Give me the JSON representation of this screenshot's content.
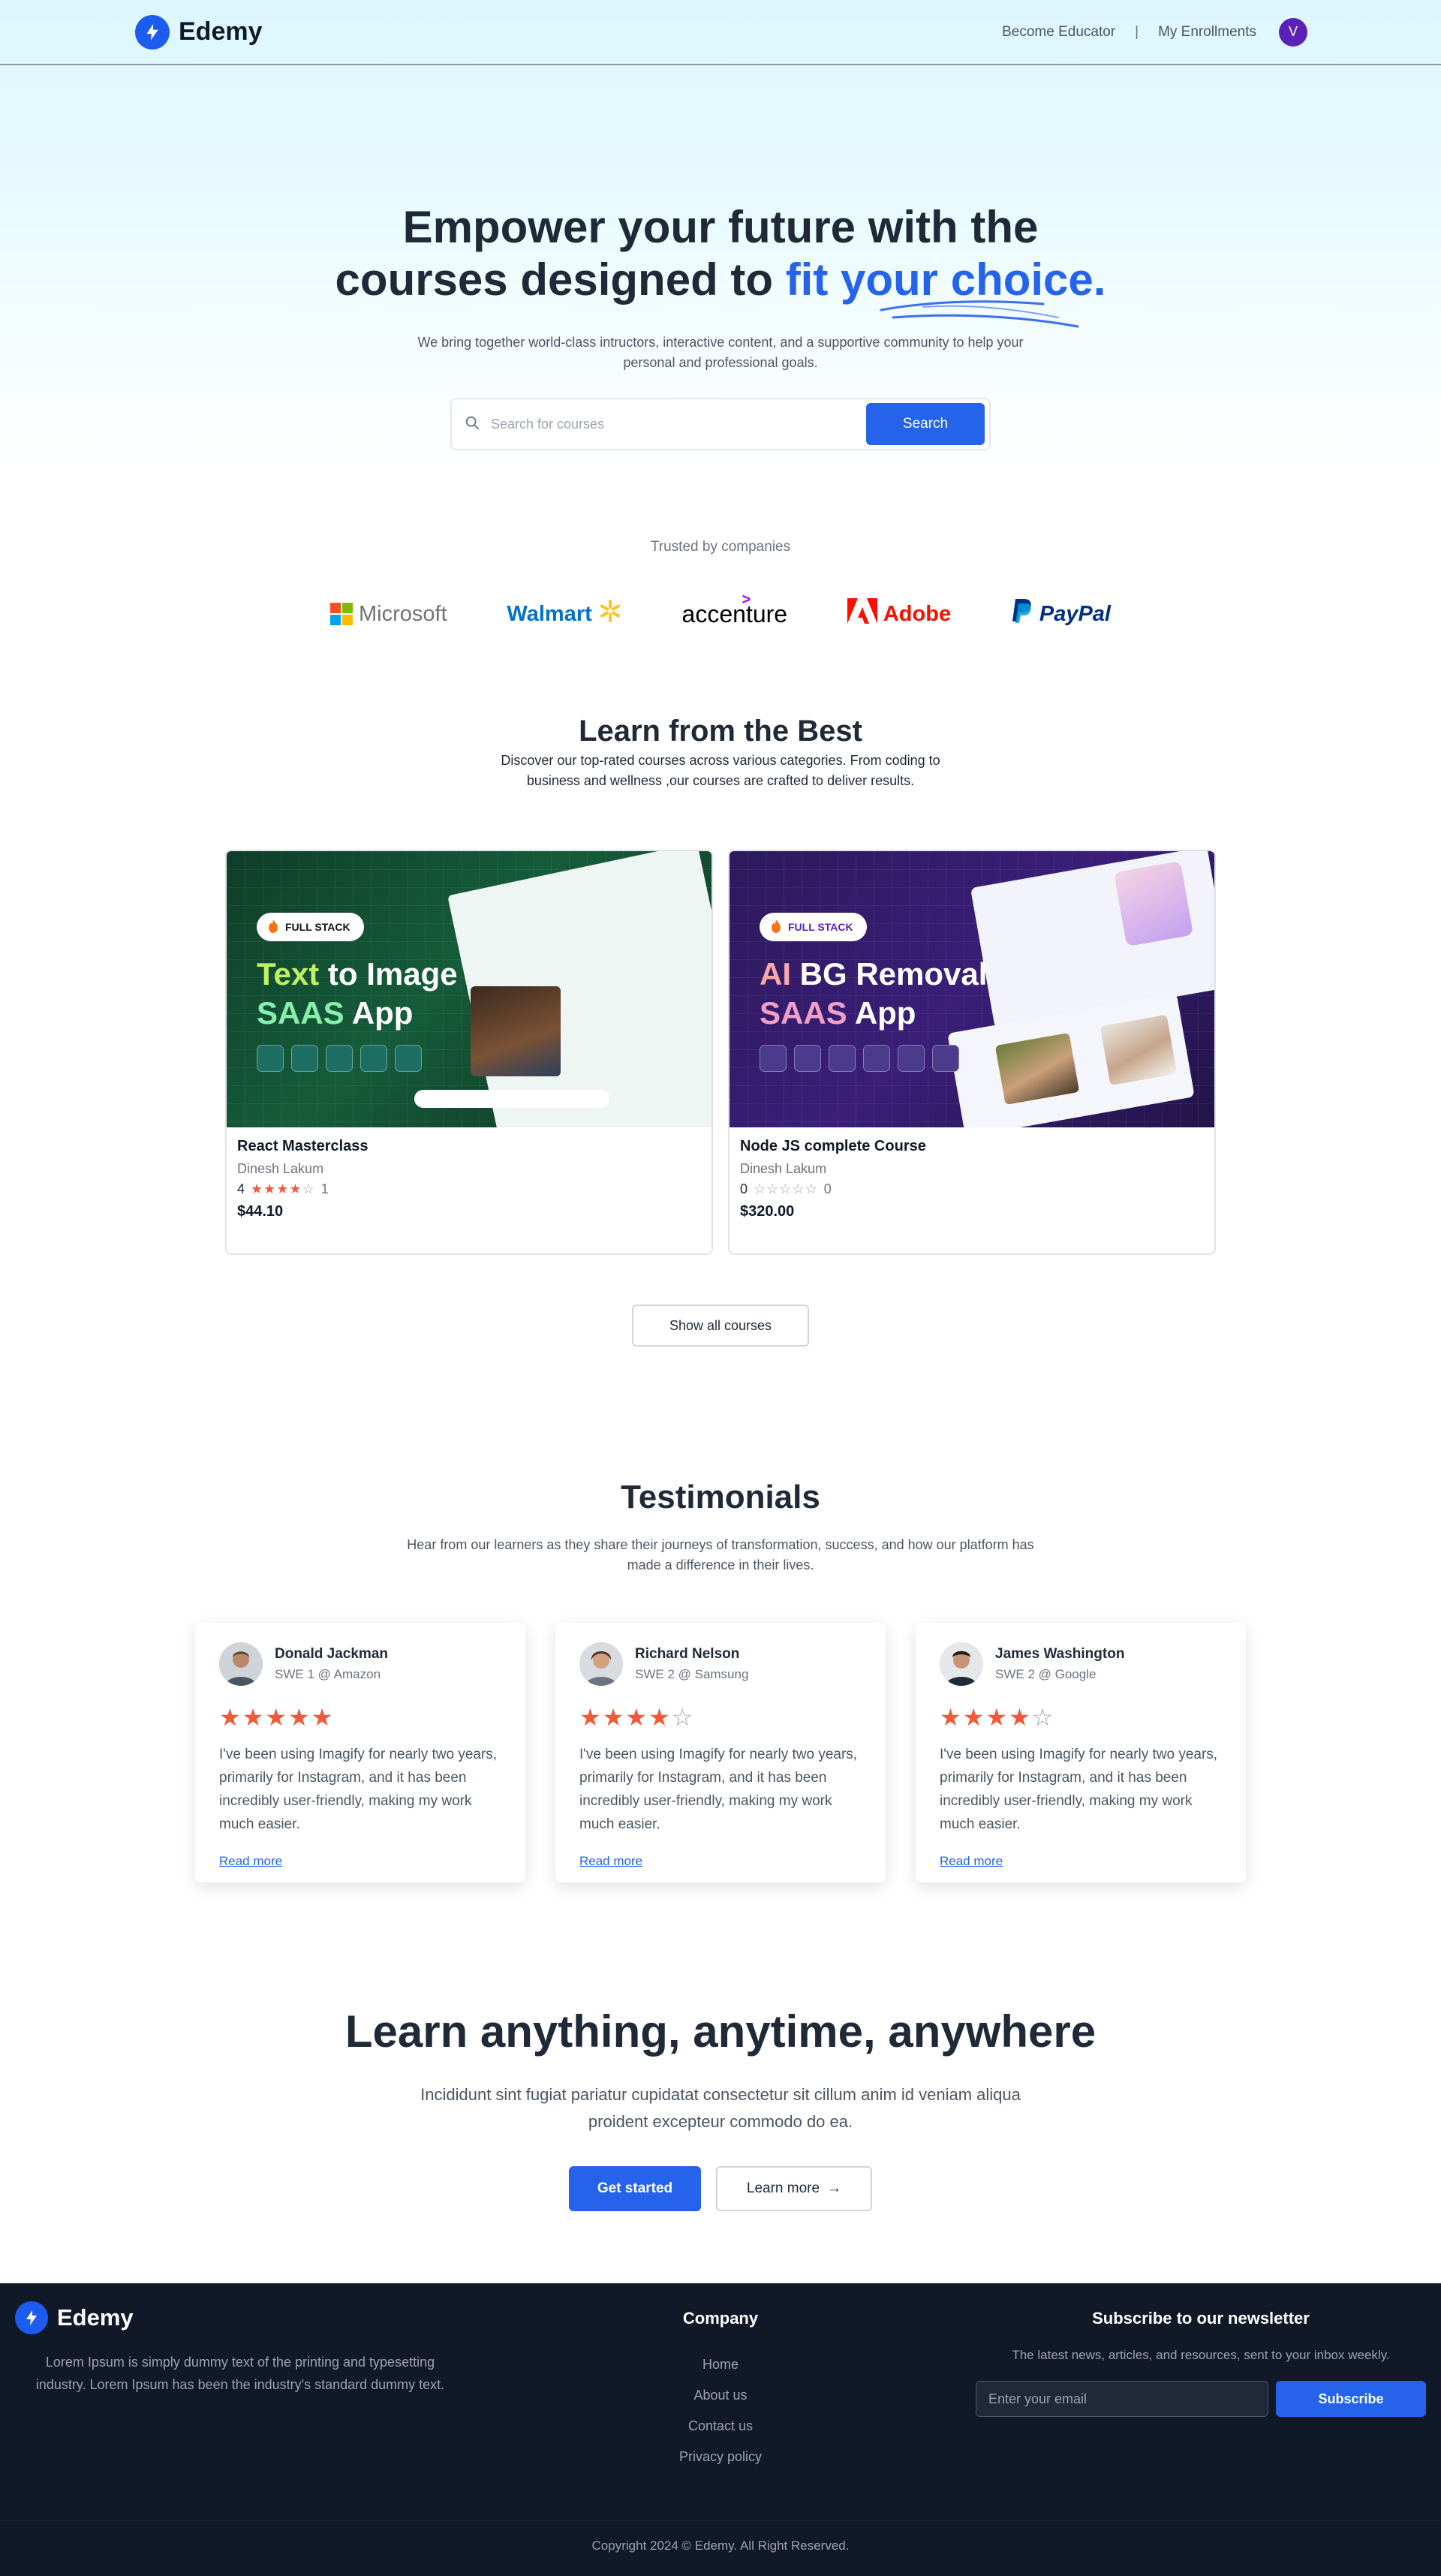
{
  "nav": {
    "brand": "Edemy",
    "become_educator": "Become Educator",
    "separator": "|",
    "my_enrollments": "My Enrollments",
    "avatar_initial": "V"
  },
  "hero": {
    "title_line1": "Empower your future with the",
    "title_line2_a": "courses designed to ",
    "title_line2_accent": "fit your choice.",
    "subtitle": "We bring together world-class intructors, interactive content, and a supportive community to help your personal and professional goals.",
    "search_placeholder": "Search for courses",
    "search_button": "Search"
  },
  "trusted": {
    "label": "Trusted by companies",
    "companies": [
      "Microsoft",
      "Walmart",
      "accenture",
      "Adobe",
      "PayPal"
    ]
  },
  "best": {
    "title": "Learn from the Best",
    "subtitle": "Discover our top-rated courses across various categories. From coding to business and wellness ,our courses are crafted to deliver results.",
    "courses": [
      {
        "badge": "FULL STACK",
        "thumb_line1_a": "Text",
        "thumb_line1_b": " to Image",
        "thumb_line2_a": "SAAS",
        "thumb_line2_b": " App",
        "title": "React Masterclass",
        "author": "Dinesh Lakum",
        "rating": "4",
        "rating_value": 4,
        "reviews": "1",
        "price": "$44.10"
      },
      {
        "badge": "FULL STACK",
        "thumb_line1_a": "AI",
        "thumb_line1_b": " BG Removal",
        "thumb_line2_a": "SAAS",
        "thumb_line2_b": " App",
        "title": "Node JS complete Course",
        "author": "Dinesh Lakum",
        "rating": "0",
        "rating_value": 0,
        "reviews": "0",
        "price": "$320.00"
      }
    ],
    "show_all": "Show all courses"
  },
  "testimonials": {
    "title": "Testimonials",
    "subtitle": "Hear from our learners as they share their journeys of transformation, success, and how our platform has made a difference in their lives.",
    "items": [
      {
        "name": "Donald Jackman",
        "role": "SWE 1 @ Amazon",
        "rating": 5,
        "text": "I've been using Imagify for nearly two years, primarily for Instagram, and it has been incredibly user-friendly, making my work much easier.",
        "read_more": "Read more"
      },
      {
        "name": "Richard Nelson",
        "role": "SWE 2 @ Samsung",
        "rating": 4,
        "text": "I've been using Imagify for nearly two years, primarily for Instagram, and it has been incredibly user-friendly, making my work much easier.",
        "read_more": "Read more"
      },
      {
        "name": "James Washington",
        "role": "SWE 2 @ Google",
        "rating": 4,
        "text": "I've been using Imagify for nearly two years, primarily for Instagram, and it has been incredibly user-friendly, making my work much easier.",
        "read_more": "Read more"
      }
    ]
  },
  "cta": {
    "title": "Learn anything, anytime, anywhere",
    "subtitle": "Incididunt sint fugiat pariatur cupidatat consectetur sit cillum anim id veniam aliqua proident excepteur commodo do ea.",
    "primary": "Get started",
    "secondary": "Learn more",
    "secondary_arrow": "→"
  },
  "footer": {
    "brand": "Edemy",
    "description": "Lorem Ipsum is simply dummy text of the printing and typesetting industry. Lorem Ipsum has been the industry's standard dummy text.",
    "company_title": "Company",
    "links": [
      "Home",
      "About us",
      "Contact us",
      "Privacy policy"
    ],
    "newsletter_title": "Subscribe to our newsletter",
    "newsletter_sub": "The latest news, articles, and resources, sent to your inbox weekly.",
    "email_placeholder": "Enter your email",
    "subscribe": "Subscribe",
    "copyright": "Copyright 2024 © Edemy. All Right Reserved."
  },
  "colors": {
    "accent": "#2563eb",
    "star": "#f05a3c",
    "footer_bg": "#111827"
  }
}
